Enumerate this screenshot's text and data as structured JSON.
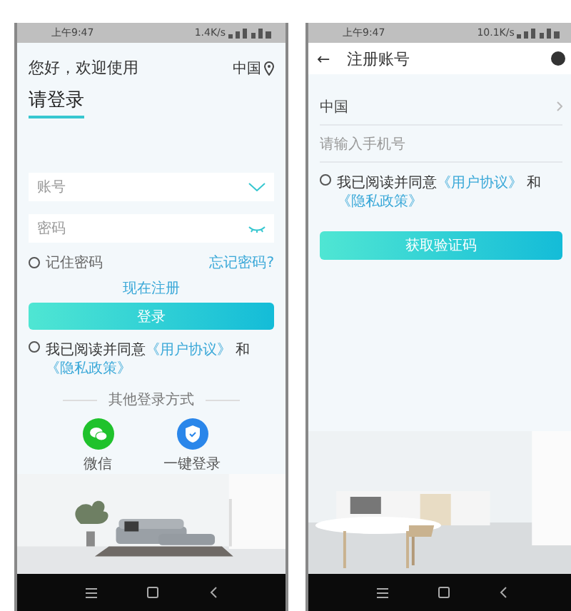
{
  "login_screen": {
    "status_bar": {
      "time": "上午9:47",
      "speed": "1.4K/s"
    },
    "greeting": "您好，欢迎使用",
    "region": "中国",
    "title": "请登录",
    "account_field": {
      "placeholder": "账号"
    },
    "password_field": {
      "placeholder": "密码"
    },
    "remember": {
      "label": "记住密码",
      "checked": false
    },
    "forgot_link": "忘记密码?",
    "register_link": "现在注册",
    "login_button": "登录",
    "agreement": {
      "checked": false,
      "text": "我已阅读并同意",
      "links": [
        "《用户协议》",
        "《隐私政策》"
      ],
      "joiner": "和"
    },
    "other_title": "其他登录方式",
    "other_methods": [
      {
        "kind": "wechat",
        "label": "微信"
      },
      {
        "kind": "onekey",
        "label": "一键登录"
      }
    ]
  },
  "register_screen": {
    "status_bar": {
      "time": "上午9:47",
      "speed": "10.1K/s"
    },
    "back": "←",
    "title": "注册账号",
    "region": "中国",
    "phone_field": {
      "placeholder": "请输入手机号"
    },
    "agreement": {
      "checked": false,
      "text": "我已阅读并同意",
      "links": [
        "《用户协议》",
        "《隐私政策》"
      ],
      "joiner": "和"
    },
    "code_button": "获取验证码"
  }
}
